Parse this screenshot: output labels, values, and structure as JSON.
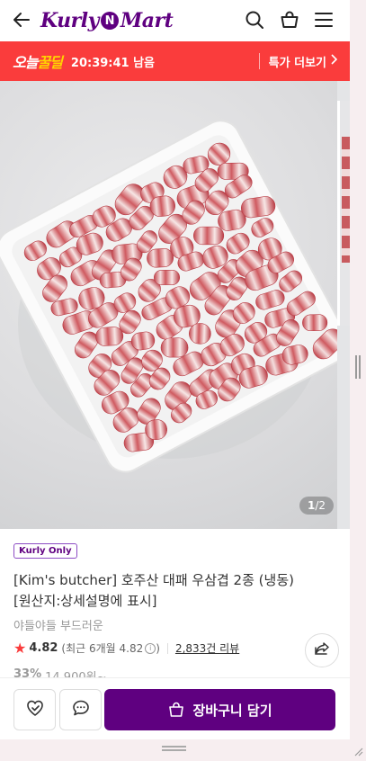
{
  "header": {
    "logo_left": "Kurly",
    "logo_n": "N",
    "logo_right": "Mart",
    "icons": [
      "back-arrow-icon",
      "search-icon",
      "basket-icon",
      "menu-icon"
    ]
  },
  "deal": {
    "title_prefix": "오늘",
    "title_highlight": "꿀딜",
    "timer": "20:39:41 남음",
    "more_label": "특가 더보기",
    "bg_color": "#fa3c3c"
  },
  "gallery": {
    "current_page": "1",
    "page_sep": "/",
    "total_pages": "2"
  },
  "product": {
    "badge": "Kurly Only",
    "title": "[Kim's butcher] 호주산 대패 우삼겹 2종 (냉동)\n[원산지:상세설명에 표시]",
    "subtitle": "야들야들 부드러운",
    "rating": "4.82",
    "rating_recent": "(최근 6개월 4.82",
    "rating_recent_close": ")",
    "reviews": "2,833건 리뷰",
    "discount": "33%",
    "original_price": "14,900원~"
  },
  "bottom": {
    "cart_label": "장바구니 담기",
    "accent": "#5f0080"
  }
}
